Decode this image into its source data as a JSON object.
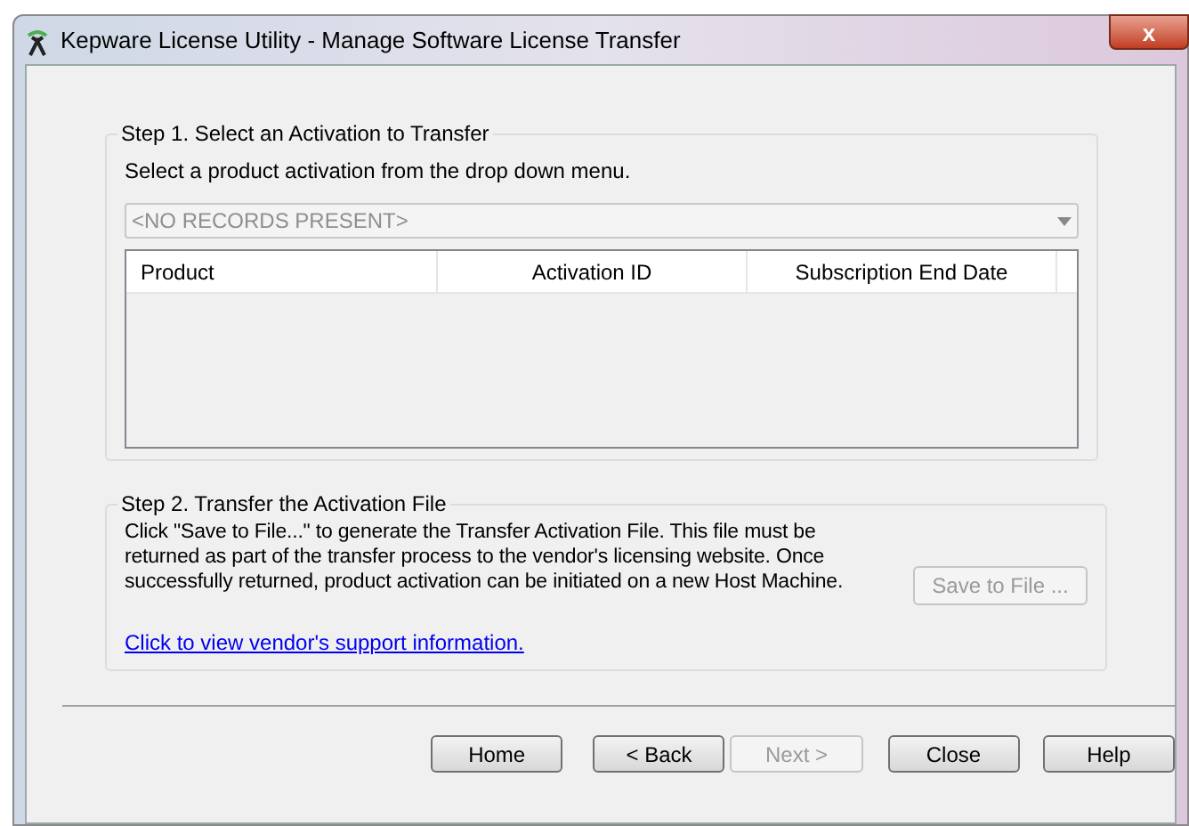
{
  "window": {
    "title": "Kepware License Utility - Manage Software License Transfer",
    "close": "x"
  },
  "step1": {
    "title": "Step 1. Select an Activation to Transfer",
    "instruction": "Select a product activation from the drop down menu.",
    "dropdown": {
      "value": "<NO RECORDS PRESENT>",
      "disabled": true
    },
    "table": {
      "columns": [
        "Product",
        "Activation ID",
        "Subscription End Date"
      ]
    }
  },
  "step2": {
    "title": "Step 2. Transfer the Activation File",
    "description": "Click \"Save to File...\" to generate the Transfer Activation File.  This file must be returned as part of the transfer process to the vendor's licensing website.  Once successfully returned, product activation can be initiated on a new Host Machine.",
    "save_button": {
      "label": "Save to File ...",
      "disabled": true
    },
    "link": "Click to view vendor's support information."
  },
  "buttons": [
    {
      "label": "Home",
      "disabled": false
    },
    {
      "label": "< Back",
      "disabled": false
    },
    {
      "label": "Next >",
      "disabled": true
    },
    {
      "label": "Close",
      "disabled": false
    },
    {
      "label": "Help",
      "disabled": false
    }
  ]
}
